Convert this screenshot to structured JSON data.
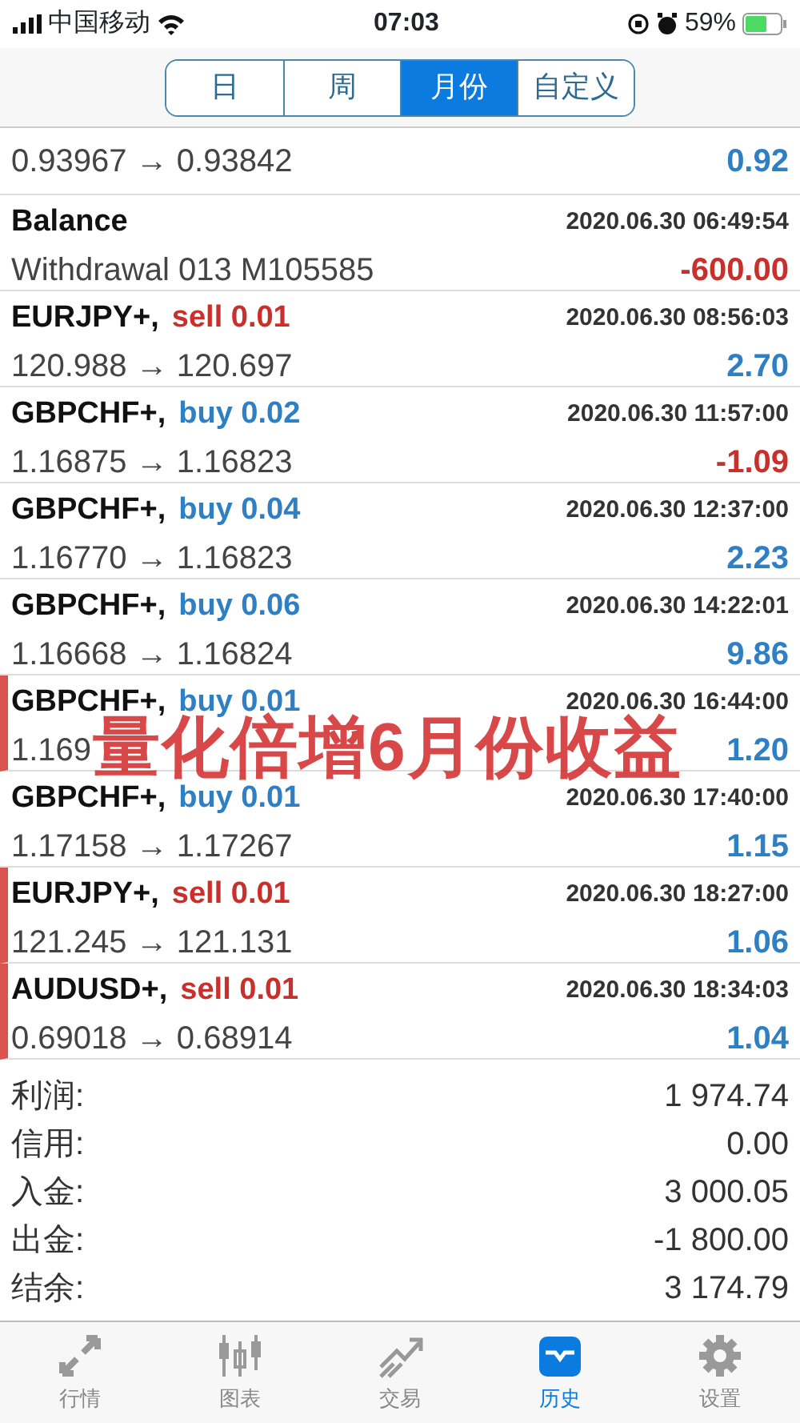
{
  "status_bar": {
    "carrier": "中国移动",
    "time": "07:03",
    "battery": "59%"
  },
  "segments": [
    {
      "label": "日",
      "selected": false
    },
    {
      "label": "周",
      "selected": false
    },
    {
      "label": "月份",
      "selected": true
    },
    {
      "label": "自定义",
      "selected": false
    }
  ],
  "first_row": {
    "prices": "0.93967 → 0.93842",
    "profit": "0.92",
    "loss": false
  },
  "rows": [
    {
      "kind": "balance",
      "symbol": "Balance",
      "time": "2020.06.30 06:49:54",
      "detail": "Withdrawal 013 M105585",
      "profit": "-600.00",
      "loss": true,
      "marked": false
    },
    {
      "kind": "sell",
      "symbol": "EURJPY+,",
      "side": "sell",
      "volume": "0.01",
      "time": "2020.06.30 08:56:03",
      "detail": "120.988 → 120.697",
      "profit": "2.70",
      "loss": false,
      "marked": false
    },
    {
      "kind": "buy",
      "symbol": "GBPCHF+,",
      "side": "buy",
      "volume": "0.02",
      "time": "2020.06.30 11:57:00",
      "detail": "1.16875 → 1.16823",
      "profit": "-1.09",
      "loss": true,
      "marked": false
    },
    {
      "kind": "buy",
      "symbol": "GBPCHF+,",
      "side": "buy",
      "volume": "0.04",
      "time": "2020.06.30 12:37:00",
      "detail": "1.16770 → 1.16823",
      "profit": "2.23",
      "loss": false,
      "marked": false
    },
    {
      "kind": "buy",
      "symbol": "GBPCHF+,",
      "side": "buy",
      "volume": "0.06",
      "time": "2020.06.30 14:22:01",
      "detail": "1.16668 → 1.16824",
      "profit": "9.86",
      "loss": false,
      "marked": false
    },
    {
      "kind": "buy",
      "symbol": "GBPCHF+,",
      "side": "buy",
      "volume": "0.01",
      "time": "2020.06.30 16:44:00",
      "detail": "1.169",
      "profit": "1.20",
      "loss": false,
      "marked": true
    },
    {
      "kind": "buy",
      "symbol": "GBPCHF+,",
      "side": "buy",
      "volume": "0.01",
      "time": "2020.06.30 17:40:00",
      "detail": "1.17158 → 1.17267",
      "profit": "1.15",
      "loss": false,
      "marked": false
    },
    {
      "kind": "sell",
      "symbol": "EURJPY+,",
      "side": "sell",
      "volume": "0.01",
      "time": "2020.06.30 18:27:00",
      "detail": "121.245 → 121.131",
      "profit": "1.06",
      "loss": false,
      "marked": true
    },
    {
      "kind": "sell",
      "symbol": "AUDUSD+,",
      "side": "sell",
      "volume": "0.01",
      "time": "2020.06.30 18:34:03",
      "detail": "0.69018 → 0.68914",
      "profit": "1.04",
      "loss": false,
      "marked": true
    }
  ],
  "annotation": "量化倍增6月份收益",
  "summary": [
    {
      "label": "利润:",
      "value": "1 974.74"
    },
    {
      "label": "信用:",
      "value": "0.00"
    },
    {
      "label": "入金:",
      "value": "3 000.05"
    },
    {
      "label": "出金:",
      "value": "-1 800.00"
    },
    {
      "label": "结余:",
      "value": "3 174.79"
    }
  ],
  "tab_bar": [
    {
      "kind": "quotes",
      "label": "行情",
      "selected": false
    },
    {
      "kind": "chart",
      "label": "图表",
      "selected": false
    },
    {
      "kind": "trade",
      "label": "交易",
      "selected": false
    },
    {
      "kind": "history",
      "label": "历史",
      "selected": true
    },
    {
      "kind": "settings",
      "label": "设置",
      "selected": false
    }
  ]
}
